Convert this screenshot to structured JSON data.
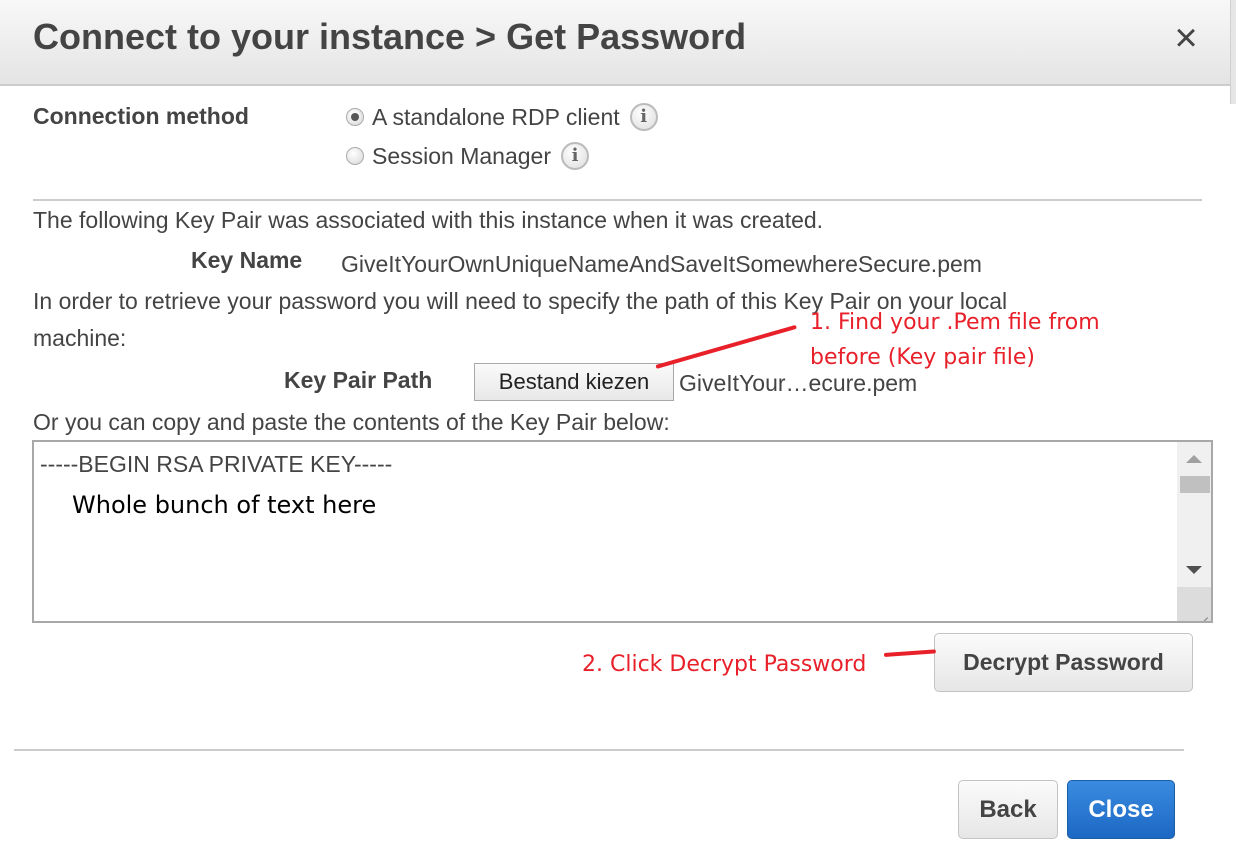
{
  "dialog": {
    "title": "Connect to your instance > Get Password",
    "close_icon": "×"
  },
  "connection": {
    "label": "Connection method",
    "options": [
      {
        "label": "A standalone RDP client",
        "selected": true,
        "info_icon": "i"
      },
      {
        "label": "Session Manager",
        "selected": false,
        "info_icon": "i"
      }
    ]
  },
  "key_pair": {
    "intro": "The following Key Pair was associated with this instance when it was created.",
    "key_name_label": "Key Name",
    "key_name_value": "GiveItYourOwnUniqueNameAndSaveItSomewhereSecure.pem",
    "path_instructions_line1": "In order to retrieve your password you will need to specify the path of this Key Pair on your local",
    "path_instructions_line2": "machine:",
    "path_label": "Key Pair Path",
    "choose_file_button": "Bestand kiezen",
    "chosen_file": "GiveItYour…ecure.pem",
    "paste_instructions": "Or you can copy and paste the contents of the Key Pair below:",
    "textarea_line1": "-----BEGIN RSA PRIVATE KEY-----",
    "textarea_line2": "Whole bunch of text here"
  },
  "actions": {
    "decrypt_button": "Decrypt Password",
    "back_button": "Back",
    "close_button": "Close"
  },
  "annotations": {
    "step1_line1": "1. Find your .Pem file from",
    "step1_line2": "before (Key pair file)",
    "step2": "2. Click Decrypt Password",
    "color": "#e8202a"
  },
  "colors": {
    "primary_button": "#1c68c4",
    "text": "#444444",
    "divider": "#cccccc"
  }
}
